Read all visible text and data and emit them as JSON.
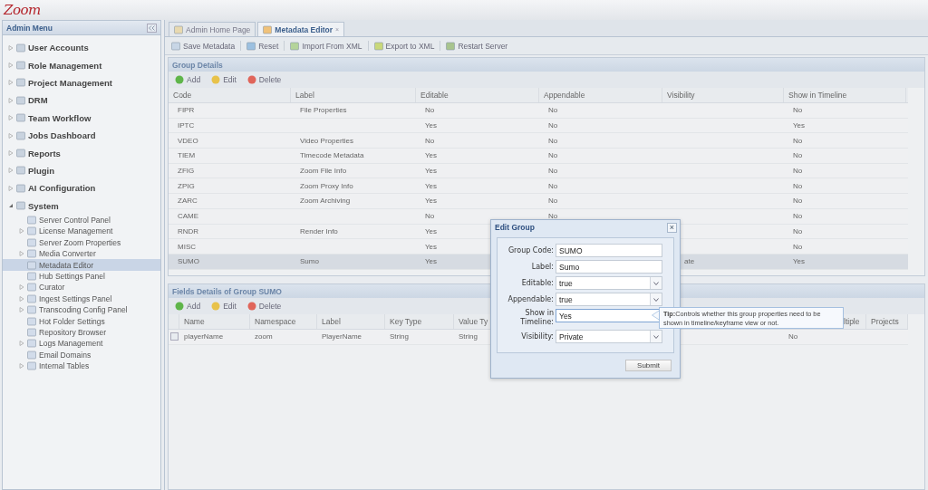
{
  "logo": "Zoom",
  "sidebar": {
    "title": "Admin Menu",
    "items": [
      {
        "label": "User Accounts",
        "expanded": false
      },
      {
        "label": "Role Management",
        "expanded": false
      },
      {
        "label": "Project Management",
        "expanded": false
      },
      {
        "label": "DRM",
        "expanded": false
      },
      {
        "label": "Team Workflow",
        "expanded": false
      },
      {
        "label": "Jobs Dashboard",
        "expanded": false
      },
      {
        "label": "Reports",
        "expanded": false
      },
      {
        "label": "Plugin",
        "expanded": false
      },
      {
        "label": "AI Configuration",
        "expanded": false
      },
      {
        "label": "System",
        "expanded": true,
        "children": [
          {
            "label": "Server Control Panel",
            "selected": false
          },
          {
            "label": "License Management",
            "expanded": false,
            "selected": false
          },
          {
            "label": "Server Zoom Properties",
            "selected": false
          },
          {
            "label": "Media Converter",
            "expanded": false,
            "selected": false
          },
          {
            "label": "Metadata Editor",
            "selected": true
          },
          {
            "label": "Hub Settings Panel",
            "selected": false
          },
          {
            "label": "Curator",
            "expanded": false,
            "selected": false
          },
          {
            "label": "Ingest Settings Panel",
            "expanded": false,
            "selected": false
          },
          {
            "label": "Transcoding Config Panel",
            "expanded": false,
            "selected": false
          },
          {
            "label": "Hot Folder Settings",
            "selected": false
          },
          {
            "label": "Repository Browser",
            "selected": false
          },
          {
            "label": "Logs Management",
            "expanded": false,
            "selected": false
          },
          {
            "label": "Email Domains",
            "selected": false
          },
          {
            "label": "Internal Tables",
            "expanded": false,
            "selected": false
          }
        ]
      }
    ]
  },
  "tabs": [
    {
      "label": "Admin Home Page",
      "selected": false
    },
    {
      "label": "Metadata Editor",
      "selected": true,
      "close": "×"
    }
  ],
  "toolbar": [
    "Save Metadata",
    "Reset",
    "Import From XML",
    "Export to XML",
    "Restart Server"
  ],
  "group_details": {
    "title": "Group Details",
    "actions": [
      "Add",
      "Edit",
      "Delete"
    ],
    "columns": [
      "Code",
      "Label",
      "Editable",
      "Appendable",
      "Visibility",
      "Show in Timeline"
    ],
    "rows": [
      {
        "selected": false,
        "cells": [
          "FIPR",
          "File Properties",
          "No",
          "No",
          null,
          "No"
        ]
      },
      {
        "selected": false,
        "cells": [
          "IPTC",
          null,
          "Yes",
          "No",
          null,
          "Yes"
        ]
      },
      {
        "selected": false,
        "cells": [
          "VDEO",
          "Video Properties",
          "No",
          "No",
          null,
          "No"
        ]
      },
      {
        "selected": false,
        "cells": [
          "TIEM",
          "Timecode Metadata",
          "Yes",
          "No",
          null,
          "No"
        ]
      },
      {
        "selected": false,
        "cells": [
          "ZFIG",
          "Zoom File Info",
          "Yes",
          "No",
          null,
          "No"
        ]
      },
      {
        "selected": false,
        "cells": [
          "ZPIG",
          "Zoom Proxy Info",
          "Yes",
          "No",
          null,
          "No"
        ]
      },
      {
        "selected": false,
        "cells": [
          "ZARC",
          "Zoom Archiving",
          "Yes",
          "No",
          null,
          "No"
        ]
      },
      {
        "selected": false,
        "cells": [
          "CAME",
          null,
          "No",
          "No",
          null,
          "No"
        ]
      },
      {
        "selected": false,
        "cells": [
          "RNDR",
          "Render Info",
          "Yes",
          null,
          null,
          "No"
        ]
      },
      {
        "selected": false,
        "cells": [
          "MISC",
          null,
          "Yes",
          null,
          null,
          "No"
        ]
      },
      {
        "selected": true,
        "cells": [
          "SUMO",
          "Sumo",
          "Yes",
          null,
          "ate",
          "Yes"
        ]
      }
    ]
  },
  "fields_details": {
    "title": "Fields Details of Group SUMO",
    "actions": [
      "Add",
      "Edit",
      "Delete"
    ],
    "columns": [
      "Name",
      "Namespace",
      "Label",
      "Key Type",
      "Value Ty",
      null,
      "ltiple",
      "Projects"
    ],
    "rows": [
      {
        "cells": [
          "playerName",
          "zoom",
          "PlayerName",
          "String",
          "String",
          null,
          "No",
          null
        ]
      }
    ]
  },
  "dialog": {
    "title": "Edit Group",
    "close": "×",
    "fields": [
      {
        "kind": "text",
        "label": "Group Code:",
        "value": "SUMO",
        "focused": false
      },
      {
        "kind": "text",
        "label": "Label:",
        "value": "Sumo",
        "focused": false
      },
      {
        "kind": "select",
        "label": "Editable:",
        "value": "true",
        "focused": false
      },
      {
        "kind": "select",
        "label": "Appendable:",
        "value": "true",
        "focused": false
      },
      {
        "kind": "text",
        "label": "Show in Timeline:",
        "value": "Yes",
        "focused": true
      },
      {
        "kind": "select",
        "label": "Visibility:",
        "value": "Private",
        "focused": false
      }
    ],
    "submit": "Submit"
  },
  "tooltip": {
    "title": "Tip:",
    "text": "Controls whether this group properties need to be shown in timeline/keyframe view or not."
  }
}
